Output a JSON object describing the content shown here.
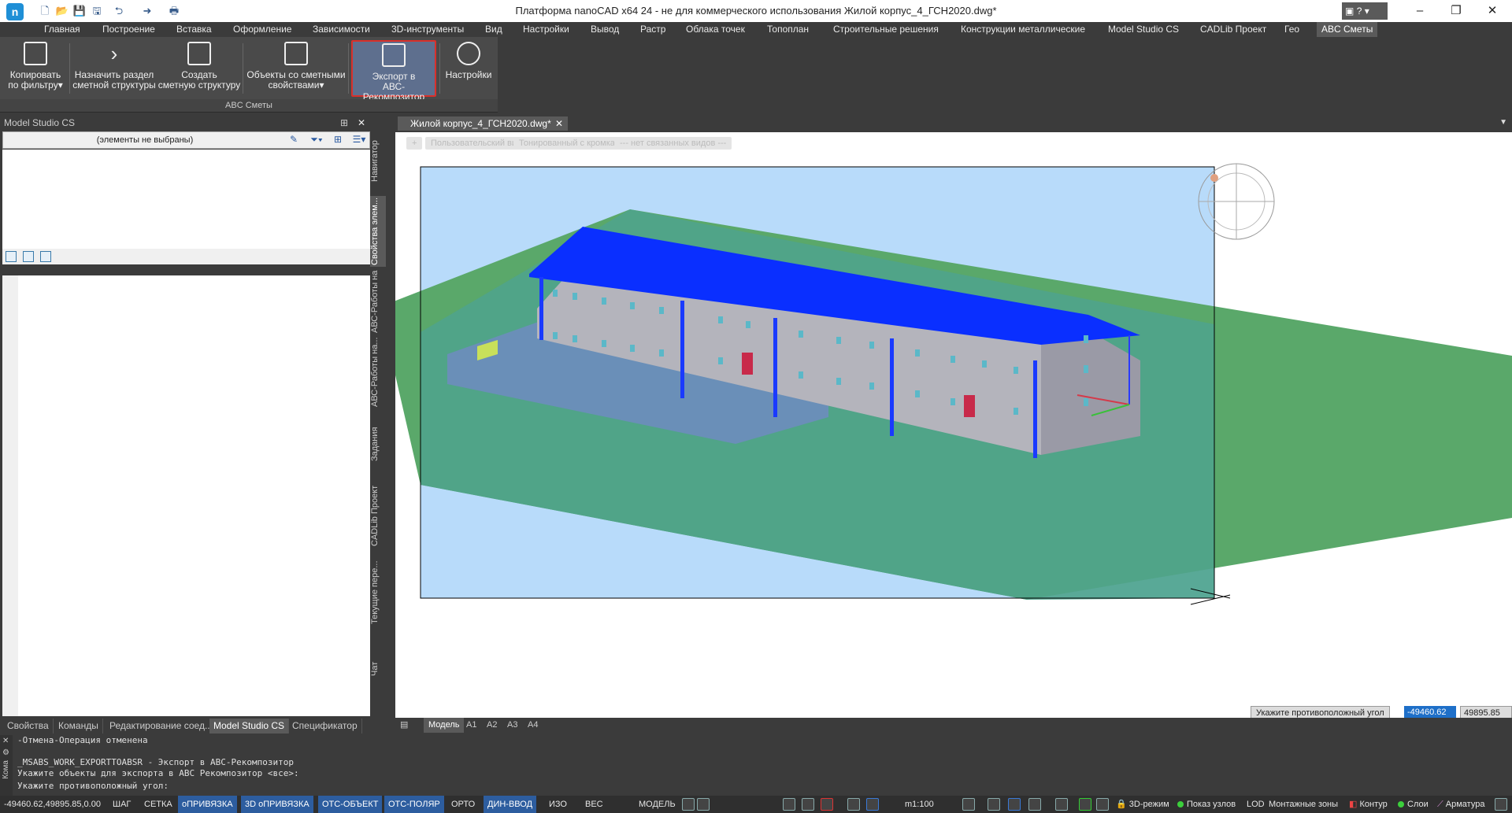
{
  "window": {
    "title": "Платформа nanoCAD x64 24 - не для коммерческого использования Жилой корпус_4_ГСН2020.dwg*",
    "logo": "logo-icon",
    "minimize": "–",
    "maximize": "❐",
    "close": "✕",
    "help": "?"
  },
  "quick_access": [
    "new-icon",
    "open-icon",
    "save-icon",
    "saveas-icon",
    "undo-icon",
    "redo-icon",
    "print-icon"
  ],
  "ribbon_tabs": [
    "Главная",
    "Построение",
    "Вставка",
    "Оформление",
    "Зависимости",
    "3D-инструменты",
    "Вид",
    "Настройки",
    "Вывод",
    "Растр",
    "Облака точек",
    "Топоплан",
    "Строительные решения",
    "Конструкции металлические",
    "Model Studio CS",
    "CADLib Проект",
    "Гео",
    "ABC Сметы"
  ],
  "ribbon": {
    "group_label": "ABC Сметы",
    "buttons": [
      {
        "line1": "Копировать",
        "line2": "по фильтру▾"
      },
      {
        "line1": "Назначить раздел",
        "line2": "сметной структуры"
      },
      {
        "line1": "Создать",
        "line2": "сметную структуру"
      },
      {
        "line1": "Объекты со сметными",
        "line2": "свойствами▾"
      },
      {
        "line1": "Экспорт в",
        "line2": "АВС-Рекомпозитор"
      },
      {
        "line1": "Настройки",
        "line2": ""
      }
    ]
  },
  "left_panel": {
    "title": "Model Studio CS",
    "pin": "⊞",
    "close": "✕",
    "selection_text": "(элементы не выбраны)",
    "side_tabs": [
      "Навигатор",
      "Свойства элем...",
      "АВС-Работы на...",
      "АВС-Работы на...",
      "Задания",
      "CADLib Проект",
      "Текущие пере...",
      "Чат"
    ],
    "bottom_tabs": [
      "Свойства",
      "Команды",
      "Редактирование соед...",
      "Model Studio CS",
      "Спецификатор"
    ]
  },
  "document": {
    "tab_label": "Жилой корпус_4_ГСН2020.dwg*",
    "close": "✕",
    "view_buttons": [
      "+",
      "Пользовательский вид",
      "Тонированный с кромками",
      "--- нет связанных видов ---"
    ],
    "prompt": "Укажите противоположный угол",
    "coord_x": "-49460.62",
    "coord_y": "49895.85",
    "layout_tabs": [
      "Модель",
      "A1",
      "A2",
      "A3",
      "A4"
    ]
  },
  "command_lines": [
    "-Отмена-Операция отменена",
    "",
    "_MSABS_WORK_EXPORTTOABSR - Экспорт в ABC-Рекомпозитор",
    "Укажите объекты для экспорта в ABC Рекомпозитор <все>:",
    "Укажите противоположный угол:"
  ],
  "command_side_label": "Кома",
  "status": {
    "coords": "-49460.62,49895.85,0.00",
    "toggles": [
      {
        "label": "ШАГ",
        "on": false
      },
      {
        "label": "СЕТКА",
        "on": false
      },
      {
        "label": "оПРИВЯЗКА",
        "on": true
      },
      {
        "label": "3D оПРИВЯЗКА",
        "on": true
      },
      {
        "label": "ОТС-ОБЪЕКТ",
        "on": true
      },
      {
        "label": "ОТС-ПОЛЯР",
        "on": true
      },
      {
        "label": "ОРТО",
        "on": false
      },
      {
        "label": "ДИН-ВВОД",
        "on": true
      },
      {
        "label": "ИЗО",
        "on": false
      },
      {
        "label": "ВЕС",
        "on": false
      }
    ],
    "model": "МОДЕЛЬ",
    "scale": "m1:100",
    "mode_3d": "3D-режим",
    "show_nodes": "Показ узлов",
    "lod": "LOD",
    "mount_zones": "Монтажные зоны",
    "contour": "Контур",
    "layers": "Слои",
    "rebar": "Арматура"
  },
  "colors": {
    "accent_blue": "#2d5d9f",
    "roof_blue": "#0a2fff",
    "ground_green": "#5aa86a",
    "sky_blue": "#b8dbfa",
    "active_button_border": "#d9302b"
  }
}
